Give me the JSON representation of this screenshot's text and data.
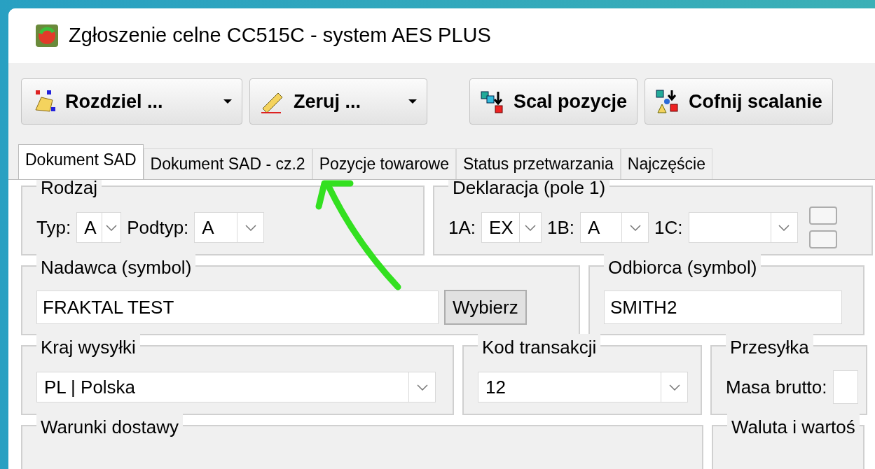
{
  "window": {
    "title": "Zgłoszenie celne CC515C - system AES PLUS"
  },
  "toolbar": [
    {
      "kind": "split",
      "label": "Rozdziel ..."
    },
    {
      "kind": "split",
      "label": "Zeruj ..."
    },
    {
      "kind": "plain",
      "label": "Scal pozycje"
    },
    {
      "kind": "plain",
      "label": "Cofnij scalanie"
    }
  ],
  "tabs": [
    {
      "label": "Dokument SAD",
      "selected": true
    },
    {
      "label": "Dokument SAD - cz.2",
      "selected": false
    },
    {
      "label": "Pozycje towarowe",
      "selected": false
    },
    {
      "label": "Status przetwarzania",
      "selected": false
    },
    {
      "label": "Najczęście",
      "selected": false
    }
  ],
  "group_rows": [
    [
      {
        "title": "Rodzaj",
        "fields": [
          {
            "kind": "combo",
            "label": "Typ:",
            "value": "A"
          },
          {
            "kind": "combo",
            "label": "Podtyp:",
            "value": "A"
          }
        ]
      },
      {
        "title": "Deklaracja (pole 1)",
        "fields": [
          {
            "kind": "combo",
            "label": "1A:",
            "value": "EX"
          },
          {
            "kind": "combo",
            "label": "1B:",
            "value": "A"
          },
          {
            "kind": "combo",
            "label": "1C:"
          },
          {
            "kind": "stub"
          }
        ]
      }
    ],
    [
      {
        "title": "Nadawca (symbol)",
        "fields": [
          {
            "kind": "text",
            "value": "FRAKTAL TEST"
          },
          {
            "kind": "button",
            "label": "Wybierz"
          }
        ]
      },
      {
        "title": "Odbiorca (symbol)",
        "fields": [
          {
            "kind": "text",
            "value": "SMITH2"
          }
        ]
      }
    ],
    [
      {
        "title": "Kraj wysyłki",
        "fields": [
          {
            "kind": "combo",
            "value": "PL | Polska"
          }
        ]
      },
      {
        "title": "Kod transakcji",
        "fields": [
          {
            "kind": "combo",
            "value": "12"
          }
        ]
      },
      {
        "title": "Przesyłka",
        "fields": [
          {
            "kind": "text",
            "label": "Masa brutto:"
          }
        ]
      }
    ],
    [
      {
        "title": "Warunki dostawy"
      },
      {
        "title": "Waluta i wartoś"
      }
    ]
  ]
}
